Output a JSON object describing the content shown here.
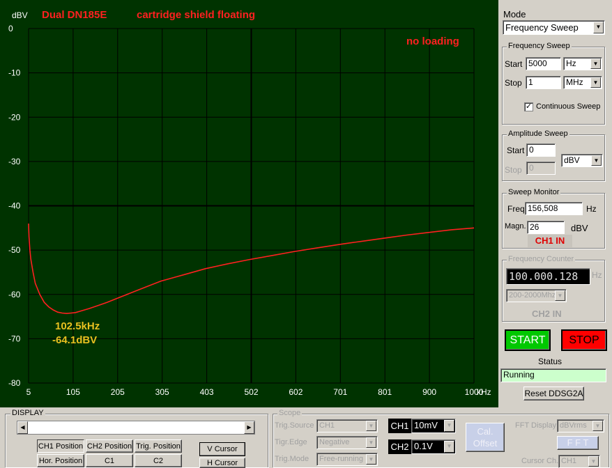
{
  "scope": {
    "title_left": "Dual DN185E",
    "title_right": "cartridge shield floating",
    "note": "no loading",
    "annotation_freq": "102.5kHz",
    "annotation_mag": "-64.1dBV",
    "y_unit": "dBV",
    "x_unit": "kHz",
    "colors": {
      "background": "#003300",
      "grid": "#000000",
      "trace": "#ff2020",
      "title": "#ff2020",
      "annotation": "#e8c020"
    }
  },
  "chart_data": {
    "type": "line",
    "title": "",
    "xlabel": "kHz",
    "ylabel": "dBV",
    "x_ticks": [
      "5",
      "105",
      "205",
      "305",
      "403",
      "502",
      "602",
      "701",
      "801",
      "900",
      "1000"
    ],
    "y_ticks": [
      "0",
      "-10",
      "-20",
      "-30",
      "-40",
      "-50",
      "-60",
      "-70",
      "-80"
    ],
    "xlim": [
      5,
      1000
    ],
    "ylim": [
      -80,
      0
    ],
    "grid": true,
    "series": [
      {
        "values_x": [
          5,
          6,
          8,
          10,
          15,
          20,
          30,
          40,
          50,
          60,
          70,
          80,
          90,
          100,
          110,
          120,
          140,
          160,
          180,
          200,
          250,
          300,
          350,
          400,
          450,
          500,
          550,
          600,
          650,
          700,
          750,
          800,
          850,
          900,
          950,
          1000
        ],
        "values_y": [
          -44,
          -47,
          -50,
          -52,
          -55,
          -57.5,
          -60,
          -61.8,
          -62.8,
          -63.5,
          -64,
          -64.2,
          -64.3,
          -64.2,
          -64.1,
          -63.8,
          -63.2,
          -62.5,
          -61.8,
          -61,
          -59,
          -57,
          -55.6,
          -54.2,
          -53.1,
          -52.1,
          -51.2,
          -50.3,
          -49.5,
          -48.7,
          -48,
          -47.3,
          -46.6,
          -46,
          -45.4,
          -45
        ]
      }
    ]
  },
  "mode": {
    "title": "Mode",
    "value": "Frequency Sweep"
  },
  "freq_sweep": {
    "title": "Frequency Sweep",
    "start_label": "Start",
    "start_value": "5000",
    "start_unit": "Hz",
    "stop_label": "Stop",
    "stop_value": "1",
    "stop_unit": "MHz",
    "continuous_label": "Continuous Sweep",
    "continuous_check": "✓"
  },
  "amp_sweep": {
    "title": "Amplitude Sweep",
    "start_label": "Start",
    "start_value": "0",
    "stop_label": "Stop",
    "stop_value": "0",
    "unit": "dBV"
  },
  "monitor": {
    "title": "Sweep Monitor",
    "freq_label": "Freq",
    "freq_value": "156,508",
    "freq_unit": "Hz",
    "magn_label": "Magn.",
    "magn_value": "26",
    "magn_unit": "dBV",
    "channel": "CH1 IN"
  },
  "counter": {
    "title": "Frequency Counter",
    "value": "100.000.128",
    "unit": "Hz",
    "range": "200-2000Mhz",
    "channel": "CH2 IN"
  },
  "controls": {
    "start": "START",
    "stop": "STOP",
    "status_label": "Status",
    "status_value": "Running",
    "reset": "Reset DDSG2A"
  },
  "display": {
    "title": "DISPLAY",
    "ch1_pos": "CH1 Position",
    "ch2_pos": "CH2 Position",
    "trig_pos": "Trig. Position",
    "v_cursor": "V Cursor",
    "hor_pos": "Hor. Position",
    "c1": "C1",
    "c2": "C2",
    "h_cursor": "H Cursor"
  },
  "scope_ctrl": {
    "title": "Scope",
    "trig_source_label": "Trig.Source",
    "trig_source_value": "CH1",
    "trig_edge_label": "Tigr.Edge",
    "trig_edge_value": "Negative",
    "trig_mode_label": "Trig.Mode",
    "trig_mode_value": "Free-running",
    "ch1_label": "CH1",
    "ch1_value": "10mV",
    "ch2_label": "CH2",
    "ch2_value": "0.1V",
    "cal_line1": "Cal.",
    "cal_line2": "Offset",
    "fft_label": "FFT Display",
    "fft_value": "dBVrms",
    "fft_btn": "F F T",
    "cursor_label": "Cursor Ch.",
    "cursor_value": "CH1"
  }
}
